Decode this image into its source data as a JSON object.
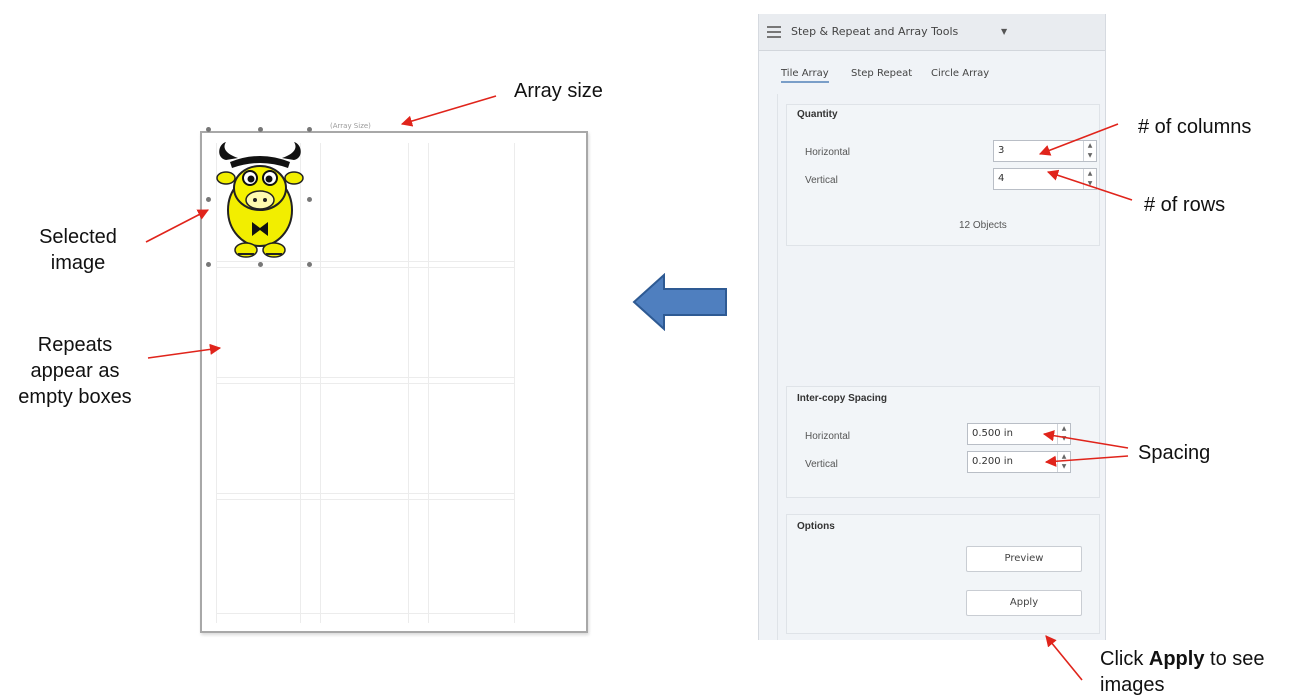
{
  "canvas": {
    "array_size_label": "(Array Size)"
  },
  "panel": {
    "title": "Step & Repeat and Array Tools",
    "tabs": [
      {
        "label": "Tile Array",
        "active": true
      },
      {
        "label": "Step Repeat",
        "active": false
      },
      {
        "label": "Circle Array",
        "active": false
      }
    ],
    "quantity": {
      "title": "Quantity",
      "horizontal_label": "Horizontal",
      "horizontal_value": "3",
      "vertical_label": "Vertical",
      "vertical_value": "4",
      "objects_count": "12 Objects"
    },
    "spacing": {
      "title": "Inter-copy Spacing",
      "horizontal_label": "Horizontal",
      "horizontal_value": "0.500 in",
      "vertical_label": "Vertical",
      "vertical_value": "0.200 in"
    },
    "options": {
      "title": "Options",
      "preview_label": "Preview",
      "apply_label": "Apply"
    }
  },
  "annotations": {
    "array_size": "Array size",
    "columns": "# of columns",
    "rows": "# of rows",
    "selected_image_line1": "Selected",
    "selected_image_line2": "image",
    "repeats_line1": "Repeats",
    "repeats_line2": "appear as",
    "repeats_line3": "empty boxes",
    "spacing": "Spacing",
    "apply_prefix": "Click ",
    "apply_bold": "Apply",
    "apply_suffix": " to see",
    "apply_line2": "images"
  },
  "colors": {
    "arrow_red": "#e0241b",
    "big_arrow_fill": "#4f7fbf",
    "big_arrow_stroke": "#2e5a93",
    "cow_yellow": "#f2ee00"
  }
}
